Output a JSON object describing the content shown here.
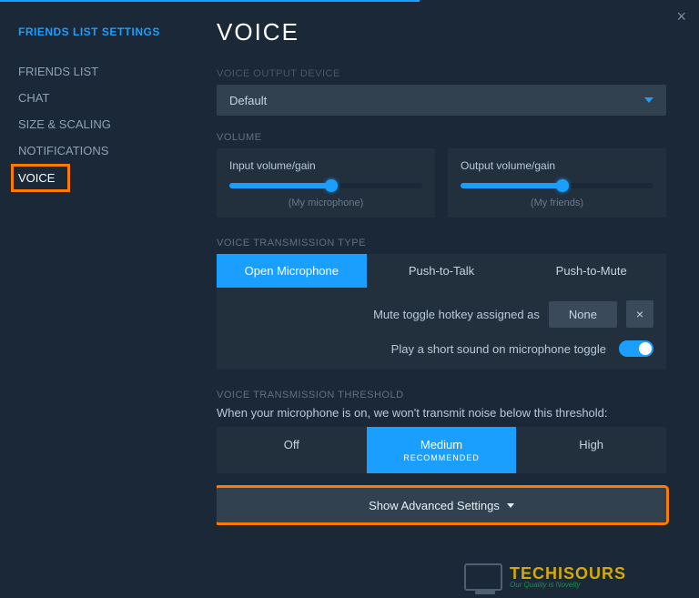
{
  "sidebar": {
    "title": "FRIENDS LIST SETTINGS",
    "items": [
      {
        "label": "FRIENDS LIST",
        "active": false
      },
      {
        "label": "CHAT",
        "active": false
      },
      {
        "label": "SIZE & SCALING",
        "active": false
      },
      {
        "label": "NOTIFICATIONS",
        "active": false
      },
      {
        "label": "VOICE",
        "active": true
      }
    ]
  },
  "page": {
    "title": "VOICE"
  },
  "output_device": {
    "section_label": "VOICE OUTPUT DEVICE",
    "value": "Default"
  },
  "volume": {
    "section_label": "VOLUME",
    "input": {
      "label": "Input volume/gain",
      "sub": "(My microphone)",
      "percent": 53
    },
    "output": {
      "label": "Output volume/gain",
      "sub": "(My friends)",
      "percent": 53
    }
  },
  "transmission": {
    "section_label": "VOICE TRANSMISSION TYPE",
    "options": [
      {
        "label": "Open Microphone",
        "active": true
      },
      {
        "label": "Push-to-Talk",
        "active": false
      },
      {
        "label": "Push-to-Mute",
        "active": false
      }
    ],
    "hotkey_label": "Mute toggle hotkey assigned as",
    "hotkey_value": "None",
    "sound_label": "Play a short sound on microphone toggle",
    "sound_on": true
  },
  "threshold": {
    "section_label": "VOICE TRANSMISSION THRESHOLD",
    "description": "When your microphone is on, we won't transmit noise below this threshold:",
    "options": [
      {
        "label": "Off",
        "active": false
      },
      {
        "label": "Medium",
        "sub": "RECOMMENDED",
        "active": true
      },
      {
        "label": "High",
        "active": false
      }
    ]
  },
  "advanced_button": "Show Advanced Settings",
  "watermark": {
    "brand": "TECHISOURS",
    "tagline": "Our Quality is Novelty"
  },
  "colors": {
    "accent": "#1a9fff",
    "highlight": "#ff7a00",
    "bg": "#1b2838",
    "panel": "#22303e"
  }
}
